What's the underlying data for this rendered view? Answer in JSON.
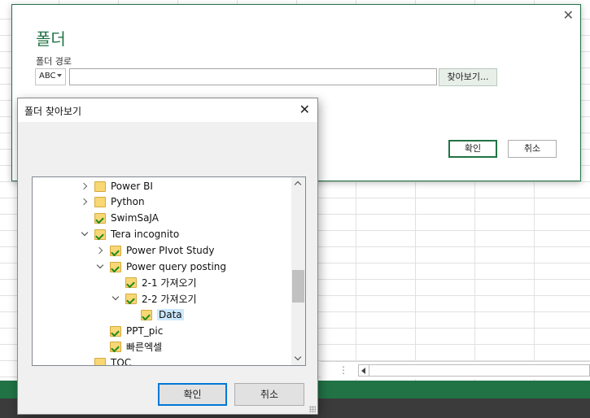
{
  "folder_dialog": {
    "title": "폴더",
    "path_label": "폴더 경로",
    "type_selector": "ABC",
    "path_value": "",
    "browse_button": "찾아보기...",
    "ok_button": "확인",
    "cancel_button": "취소"
  },
  "browse_dialog": {
    "title": "폴더 찾아보기",
    "ok_button": "확인",
    "cancel_button": "취소",
    "tree": [
      {
        "label": "Power BI",
        "expander": "closed",
        "synced": false
      },
      {
        "label": "Python",
        "expander": "closed",
        "synced": false
      },
      {
        "label": "SwimSaJA",
        "expander": "none",
        "synced": true
      },
      {
        "label": "Tera incognito",
        "expander": "open",
        "synced": true
      },
      {
        "label": "Power PIvot Study",
        "expander": "closed",
        "synced": true
      },
      {
        "label": "Power query posting",
        "expander": "open",
        "synced": true
      },
      {
        "label": "2-1 가져오기",
        "expander": "none",
        "synced": true
      },
      {
        "label": "2-2 가져오기",
        "expander": "open",
        "synced": true
      },
      {
        "label": "Data",
        "expander": "none",
        "synced": true,
        "selected": true
      },
      {
        "label": "PPT_pic",
        "expander": "none",
        "synced": true
      },
      {
        "label": "빠른엑셀",
        "expander": "none",
        "synced": true
      },
      {
        "label": "TOC",
        "expander": "none",
        "synced": false
      }
    ]
  },
  "colors": {
    "excel_green": "#217346",
    "selection": "#cce8ff",
    "folder_yellow": "#f8d775",
    "sync_check": "#1f8a1f"
  }
}
